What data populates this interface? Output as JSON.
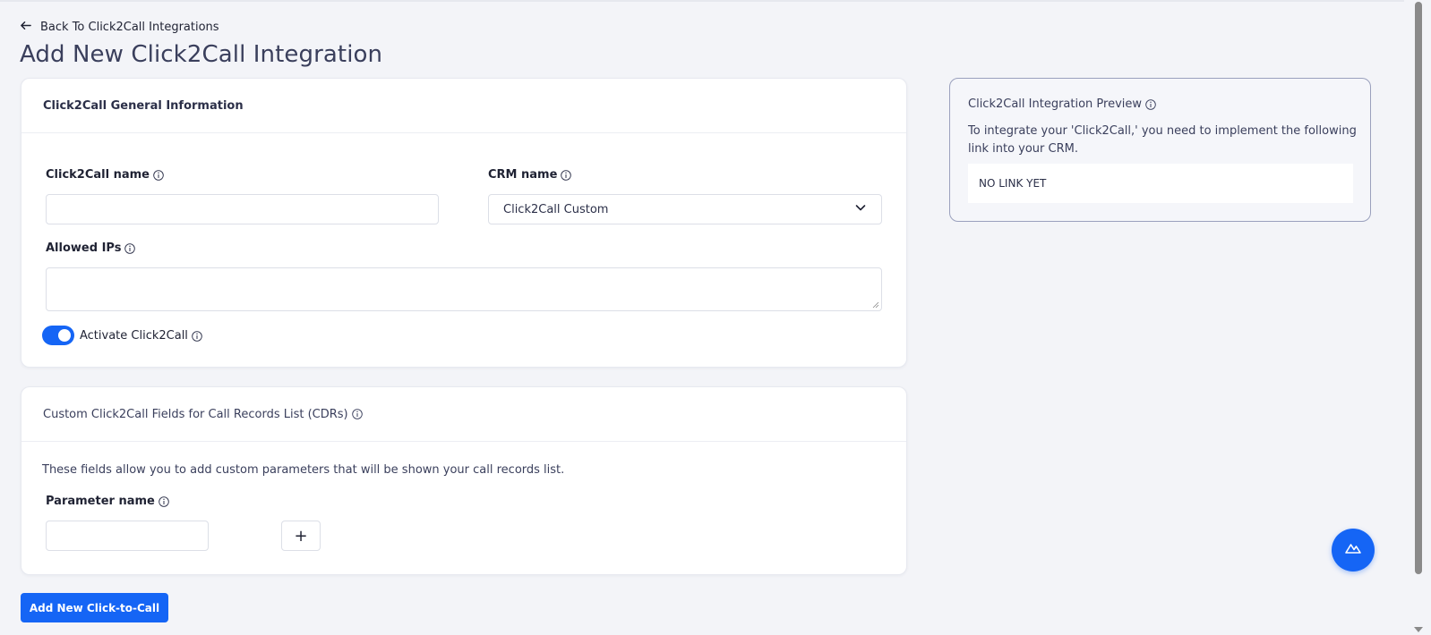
{
  "nav": {
    "back_label": "Back To Click2Call Integrations"
  },
  "page": {
    "title": "Add New Click2Call Integration"
  },
  "general": {
    "header": "Click2Call General Information",
    "click2call_name": {
      "label": "Click2Call name",
      "value": "",
      "placeholder": ""
    },
    "crm_name": {
      "label": "CRM name",
      "selected": "Click2Call Custom"
    },
    "allowed_ips": {
      "label": "Allowed IPs",
      "value": ""
    },
    "activate": {
      "label": "Activate Click2Call",
      "enabled": true
    }
  },
  "custom_fields": {
    "header": "Custom Click2Call Fields for Call Records List (CDRs)",
    "description": "These fields allow you to add custom parameters that will be shown your call records list.",
    "parameter_name": {
      "label": "Parameter name",
      "value": ""
    },
    "add_symbol": "+"
  },
  "submit_label": "Add New Click-to-Call",
  "preview": {
    "title": "Click2Call Integration Preview",
    "description": "To integrate your 'Click2Call,' you need to implement the following link into your CRM.",
    "link": "NO LINK YET"
  },
  "colors": {
    "accent": "#1565f5",
    "background": "#f3f4f8"
  },
  "icons": {
    "back": "arrow-left-icon",
    "info": "info-icon",
    "dropdown": "chevron-down-icon",
    "fab": "support-chat-icon"
  }
}
